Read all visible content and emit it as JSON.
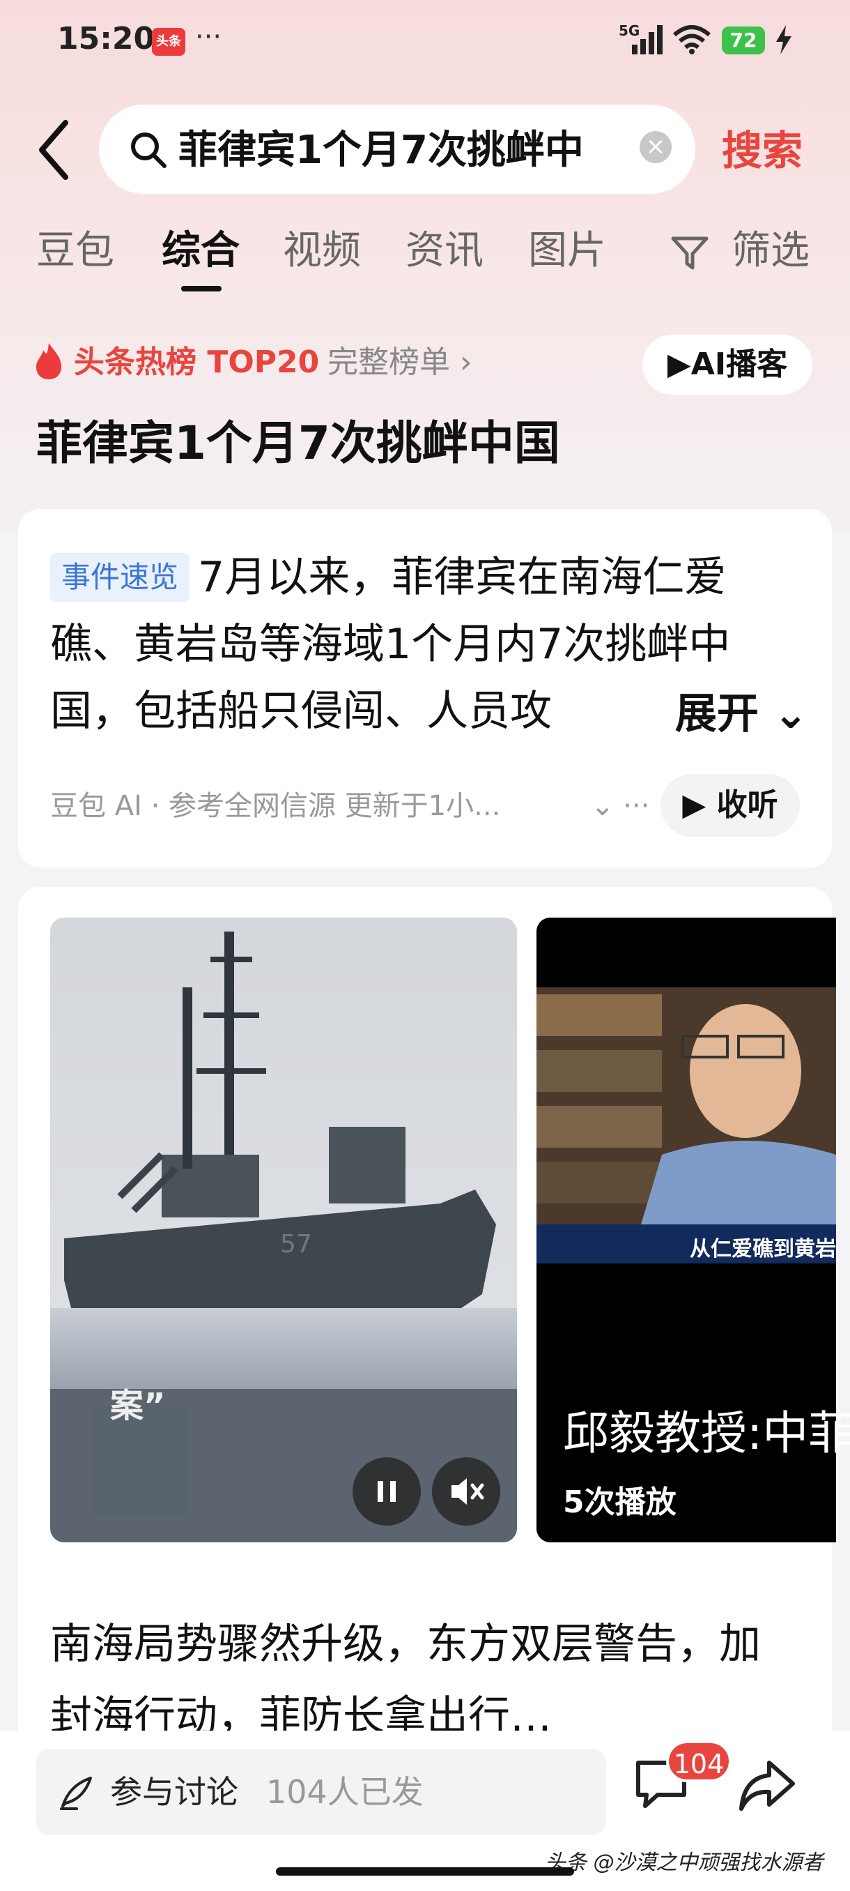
{
  "status_bar": {
    "time": "15:20",
    "app_badge": "头条",
    "more": "···",
    "network": "5G",
    "battery": "72"
  },
  "search": {
    "query": "菲律宾1个月7次挑衅中",
    "button_label": "搜索"
  },
  "tabs": [
    {
      "label": "豆包",
      "active": false
    },
    {
      "label": "综合",
      "active": true
    },
    {
      "label": "视频",
      "active": false
    },
    {
      "label": "资讯",
      "active": false
    },
    {
      "label": "图片",
      "active": false
    },
    {
      "label": "筛选",
      "active": false
    }
  ],
  "hot_list": {
    "label": "头条热榜 TOP20",
    "full_list": "完整榜单 ›",
    "ai_button": "▶AI播客",
    "topic_title": "菲律宾1个月7次挑衅中国"
  },
  "summary_card": {
    "tag": "事件速览",
    "text": "7月以来，菲律宾在南海仁爱礁、黄岩岛等海域1个月内7次挑衅中国，包括船只侵闯、人员攻",
    "expand_label": "展开 ⌄",
    "source": "豆包 AI · 参考全网信源 更新于1小...",
    "source_more": "⌄ ···",
    "listen_label": "▶ 收听"
  },
  "media_card": {
    "video1_overlay_text": "案”",
    "video2_caption": "从仁爱礁到黄岩岛",
    "video2_title": "邱毅教授:中菲",
    "video2_plays": "5次播放",
    "headline": "南海局势骤然升级，东方双层警告，加封海行动，菲防长拿出行…"
  },
  "bottom_bar": {
    "discuss_label": "参与讨论",
    "discuss_count": "104人已发",
    "comment_badge": "104"
  },
  "watermark": "头条 @沙漠之中顽强找水源者",
  "colors": {
    "accent_red": "#e8453f",
    "tag_blue": "#3a76d8",
    "battery_green": "#3dc14a"
  }
}
